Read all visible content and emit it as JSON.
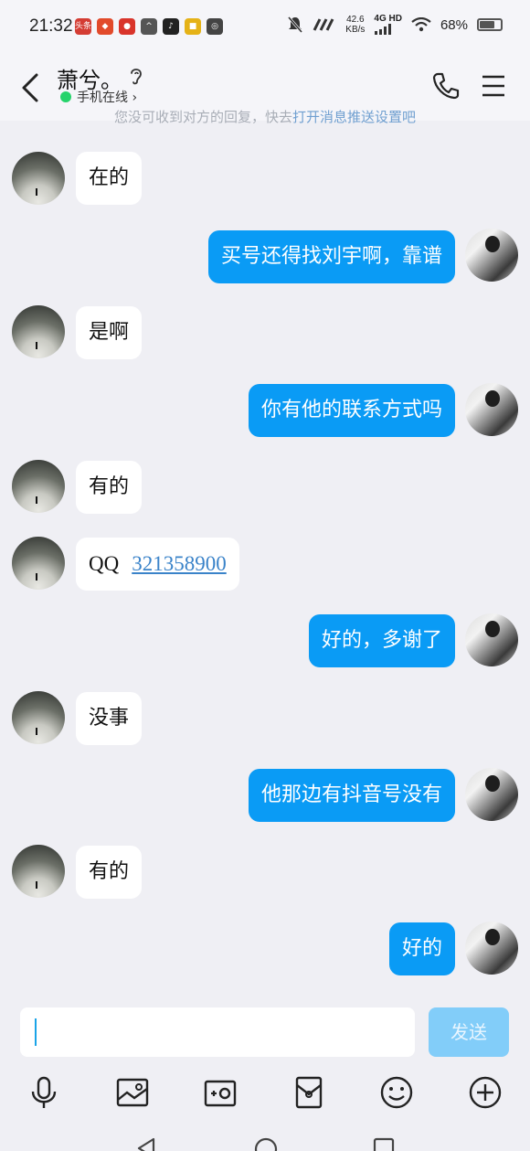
{
  "status_bar": {
    "time": "21:32",
    "apps": [
      {
        "icon": "toutiao-icon",
        "text": "头条",
        "color": "#d43c33"
      },
      {
        "icon": "app-red-icon",
        "text": "",
        "color": "#e24a2b"
      },
      {
        "icon": "app-game-icon",
        "text": "",
        "color": "#d9342b"
      },
      {
        "icon": "cat-icon",
        "text": "",
        "color": "#555555"
      },
      {
        "icon": "tiktok-icon",
        "text": "",
        "color": "#222222"
      },
      {
        "icon": "app-yellow-icon",
        "text": "",
        "color": "#e5b217"
      },
      {
        "icon": "app-gray-icon",
        "text": "",
        "color": "#444444"
      }
    ],
    "speed_value": "42.6",
    "speed_unit": "KB/s",
    "network": "4G HD",
    "battery": "68%"
  },
  "header": {
    "name": "萧兮。",
    "status": "手机在线 ›"
  },
  "notice": {
    "text": "您没可收到对方的回复，快去",
    "link": "打开消息推送设置吧"
  },
  "messages": [
    {
      "side": "peer",
      "text": "在的"
    },
    {
      "side": "self",
      "text": "买号还得找刘宇啊，靠谱"
    },
    {
      "side": "peer",
      "text": "是啊"
    },
    {
      "side": "self",
      "text": "你有他的联系方式吗"
    },
    {
      "side": "peer",
      "text": "有的"
    },
    {
      "side": "peer",
      "qq_label": "QQ",
      "qq_number": "321358900"
    },
    {
      "side": "self",
      "text": "好的，多谢了"
    },
    {
      "side": "peer",
      "text": "没事"
    },
    {
      "side": "self",
      "text": "他那边有抖音号没有"
    },
    {
      "side": "peer",
      "text": "有的"
    },
    {
      "side": "self",
      "text": "好的"
    }
  ],
  "input": {
    "placeholder": "",
    "send_label": "发送"
  },
  "toolbar": [
    "microphone-icon",
    "image-icon",
    "camera-icon",
    "red-packet-icon",
    "emoji-icon",
    "plus-icon"
  ],
  "colors": {
    "self_bubble": "#0a9bf5",
    "peer_bubble": "#ffffff",
    "background": "#efeff4",
    "send_disabled": "#82cdf9"
  }
}
